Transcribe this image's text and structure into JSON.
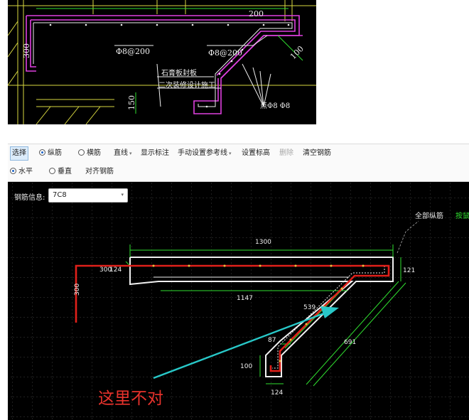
{
  "cad_view": {
    "dim_top": "200",
    "dim_left": "300",
    "rebar_label_1": "Φ8@200",
    "rebar_label_2": "Φ8@200",
    "note_line_1": "石膏板封板",
    "note_line_2": "二次装修设计施工",
    "dim_left_lower": "150",
    "dim_right": "100",
    "rebar_label_3": "点Φ8 Φ8"
  },
  "toolbar_top": {
    "select_label": "选择",
    "longitudinal_label": "纵筋",
    "transverse_label": "横筋",
    "line_label": "直线",
    "show_dim_label": "显示标注",
    "manual_ref_label": "手动设置参考线",
    "set_height_label": "设置标高",
    "delete_label": "删除",
    "clear_label": "清空钢筋"
  },
  "toolbar_second": {
    "horizontal_label": "水平",
    "vertical_label": "垂直",
    "align_label": "对齐钢筋"
  },
  "canvas": {
    "rebar_info_label": "钢筋信息:",
    "rebar_info_value": "7C8",
    "all_longitudinal_label": "全部纵筋",
    "draw_label": "按鼠",
    "dims": {
      "top": "1300",
      "left": "300",
      "left_short": "124",
      "left_vertical": "300",
      "bottom_long": "1147",
      "right": "121",
      "diag_inner": "539",
      "diag_outer": "691",
      "small": "87",
      "end_height": "100",
      "bottom_short": "124"
    }
  },
  "annotation": "这里不对",
  "colors": {
    "cad_bg": "#000000",
    "cad_magenta": "#e040e0",
    "cad_yellow": "#d8d840",
    "rebar_red": "#e0201a",
    "outline_white": "#f0f0f0",
    "dim_green": "#30e030",
    "arrow_cyan": "#28c8c8",
    "annotation_red": "#e8322c"
  }
}
